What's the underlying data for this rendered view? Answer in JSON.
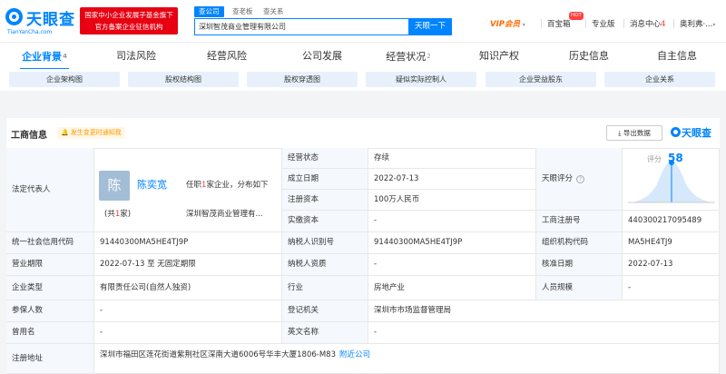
{
  "brand": {
    "name": "天眼查",
    "domain": "TianYanCha.com",
    "gov_line1": "国家中小企业发展子基金旗下",
    "gov_line2": "官方备案企业征信机构",
    "color": "#0084ff"
  },
  "search": {
    "tabs": [
      "查公司",
      "查老板",
      "查关系"
    ],
    "value": "深圳智茂商业管理有限公司",
    "button": "天眼一下"
  },
  "topnav": {
    "vip": "VIP会员",
    "vip_caret": "▾",
    "baixiang": "百宝箱",
    "hot": "HOT",
    "pro": "专业版",
    "msg": "消息中心",
    "msg_count": "4",
    "user": "奥利弗·...",
    "user_caret": "▾"
  },
  "tabs": [
    {
      "label": "企业背景",
      "count": "4"
    },
    {
      "label": "司法风险",
      "count": ""
    },
    {
      "label": "经营风险",
      "count": ""
    },
    {
      "label": "公司发展",
      "count": ""
    },
    {
      "label": "经营状况",
      "count": "2"
    },
    {
      "label": "知识产权",
      "count": ""
    },
    {
      "label": "历史信息",
      "count": ""
    },
    {
      "label": "自主信息",
      "count": ""
    }
  ],
  "subtabs": [
    "企业架构图",
    "股权结构图",
    "股权穿透图",
    "疑似实际控制人",
    "企业受益股东",
    "企业关系"
  ],
  "section": {
    "title": "工商信息",
    "notice": "发生变更时通知我",
    "bell": "🔔",
    "export": "导出数据",
    "export_icon": "⤓",
    "brand": "天眼查"
  },
  "legal": {
    "label": "法定代表人",
    "avatar": "陈",
    "name": "陈奕宽",
    "info_prefix": "任职",
    "info_num": "1",
    "info_suffix": "家企业，分布如下",
    "count_prefix": "(共",
    "count_num": "1",
    "count_suffix": "家)",
    "company": "深圳智茂商业管理有..."
  },
  "score": {
    "label": "天眼评分",
    "help": "?",
    "caption": "评分",
    "value": "58"
  },
  "fields": {
    "status_l": "经营状态",
    "status_v": "存续",
    "estab_l": "成立日期",
    "estab_v": "2022-07-13",
    "capital_l": "注册资本",
    "capital_v": "100万人民币",
    "paid_l": "实缴资本",
    "paid_v": "-",
    "regno_l": "工商注册号",
    "regno_v": "440300217095489",
    "credit_l": "统一社会信用代码",
    "credit_v": "91440300MA5HE4TJ9P",
    "taxid_l": "纳税人识别号",
    "taxid_v": "91440300MA5HE4TJ9P",
    "org_l": "组织机构代码",
    "org_v": "MA5HE4TJ9",
    "term_l": "营业期限",
    "term_v": "2022-07-13 至 无固定期限",
    "taxq_l": "纳税人资质",
    "taxq_v": "-",
    "appr_l": "核准日期",
    "appr_v": "2022-07-13",
    "type_l": "企业类型",
    "type_v": "有限责任公司(自然人独资)",
    "ind_l": "行业",
    "ind_v": "房地产业",
    "size_l": "人员规模",
    "size_v": "-",
    "ins_l": "参保人数",
    "ins_v": "-",
    "auth_l": "登记机关",
    "auth_v": "深圳市市场监督管理局",
    "former_l": "曾用名",
    "former_v": "-",
    "en_l": "英文名称",
    "en_v": "-",
    "addr_l": "注册地址",
    "addr_v": "深圳市福田区莲花街道紫荆社区深南大道6006号华丰大厦1806-M83",
    "addr_link": "附近公司"
  }
}
